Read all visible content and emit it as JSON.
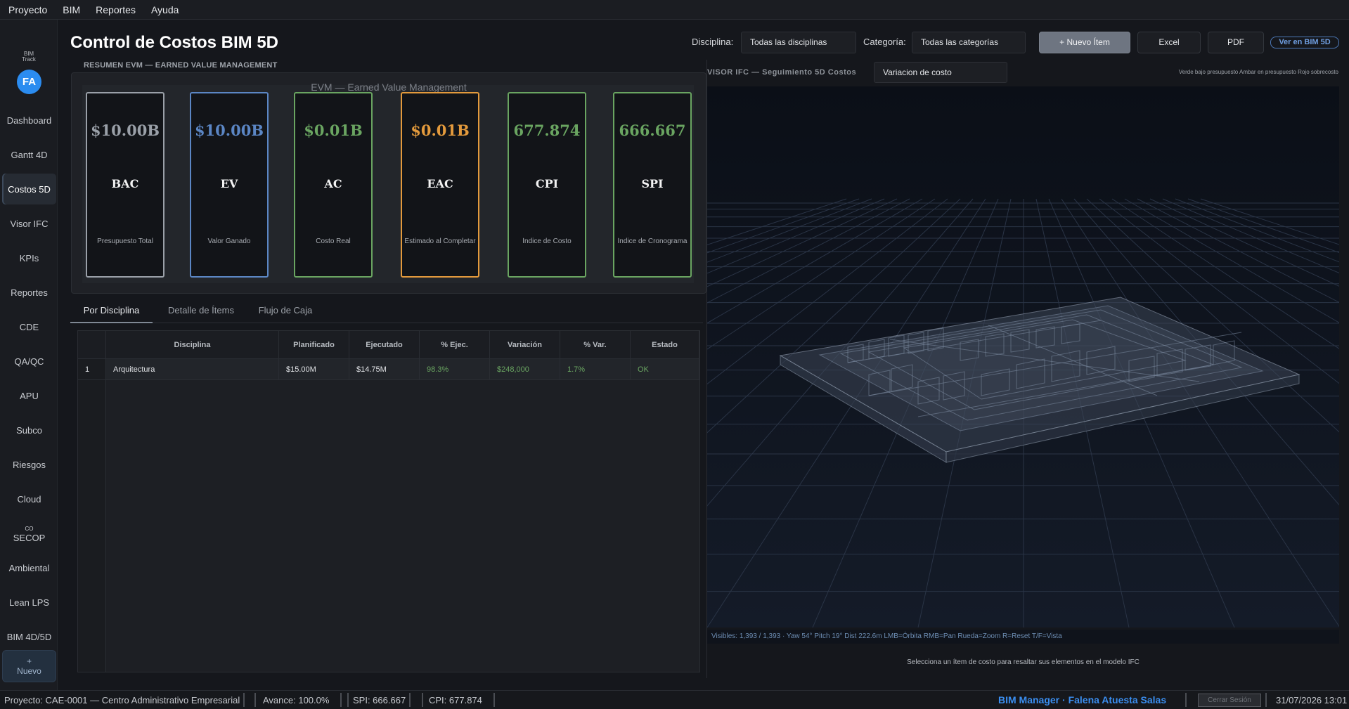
{
  "menu": [
    "Proyecto",
    "BIM",
    "Reportes",
    "Ayuda"
  ],
  "sidebar": {
    "brand_line1": "BIM",
    "brand_line2": "Track",
    "avatar": "FA",
    "items": [
      {
        "label": "Dashboard"
      },
      {
        "label": "Gantt 4D"
      },
      {
        "label": "Costos 5D",
        "active": true
      },
      {
        "label": "Visor IFC"
      },
      {
        "label": "KPIs"
      },
      {
        "label": "Reportes"
      },
      {
        "label": "CDE"
      },
      {
        "label": "QA/QC"
      },
      {
        "label": "APU"
      },
      {
        "label": "Subco"
      },
      {
        "label": "Riesgos"
      },
      {
        "label": "Cloud"
      },
      {
        "label": "SECOP",
        "prefix": "CO"
      },
      {
        "label": "Ambiental"
      },
      {
        "label": "Lean LPS"
      },
      {
        "label": "BIM 4D/5D"
      }
    ],
    "new_plus": "+",
    "new_label": "Nuevo"
  },
  "header": {
    "title": "Control de Costos BIM 5D",
    "disciplina_label": "Disciplina:",
    "disciplina_value": "Todas las disciplinas",
    "categoria_label": "Categoría:",
    "categoria_value": "Todas las categorías",
    "nuevo_item": "+ Nuevo Ítem",
    "excel": "Excel",
    "pdf": "PDF",
    "ver_bim": "Ver en BIM 5D"
  },
  "evm": {
    "heading": "RESUMEN EVM — EARNED VALUE MANAGEMENT",
    "panel_title": "EVM — Earned Value Management",
    "cards": [
      {
        "value": "$10.00B",
        "label": "BAC",
        "desc": "Presupuesto Total",
        "color": "#9aa0a8"
      },
      {
        "value": "$10.00B",
        "label": "EV",
        "desc": "Valor Ganado",
        "color": "#5b86c4"
      },
      {
        "value": "$0.01B",
        "label": "AC",
        "desc": "Costo Real",
        "color": "#6aa561"
      },
      {
        "value": "$0.01B",
        "label": "EAC",
        "desc": "Estimado al Completar",
        "color": "#e39a3c"
      },
      {
        "value": "677.874",
        "label": "CPI",
        "desc": "Índice de Costo",
        "color": "#6aa561"
      },
      {
        "value": "666.667",
        "label": "SPI",
        "desc": "Índice de Cronograma",
        "color": "#6aa561"
      }
    ]
  },
  "tabs": [
    {
      "label": "Por Disciplina",
      "active": true
    },
    {
      "label": "Detalle de Ítems"
    },
    {
      "label": "Flujo de Caja"
    }
  ],
  "table": {
    "headers": [
      "Disciplina",
      "Planificado",
      "Ejecutado",
      "% Ejec.",
      "Variación",
      "% Var.",
      "Estado"
    ],
    "rows": [
      {
        "index": "1",
        "cells": [
          "Arquitectura",
          "$15.00M",
          "$14.75M",
          "98.3%",
          "$248,000",
          "1.7%",
          "OK"
        ]
      }
    ],
    "positive_color": "#6aa561"
  },
  "viewer": {
    "title": "VISOR IFC — Seguimiento 5D Costos",
    "mode_value": "Variacion de costo",
    "legend": "Verde bajo presupuesto Ambar en presupuesto Rojo sobrecosto",
    "status": "Visibles: 1,393 / 1,393 · Yaw 54° Pitch 19° Dist 222.6m  LMB=Órbita RMB=Pan Rueda=Zoom R=Reset T/F=Vista",
    "hint": "Selecciona un ítem de costo para resaltar sus elementos en el modelo IFC"
  },
  "statusbar": {
    "project": "Proyecto: CAE-0001 — Centro Administrativo Empresarial",
    "avance": "Avance: 100.0%",
    "spi": "SPI: 666.667",
    "cpi": "CPI: 677.874",
    "user": "BIM Manager · Falena Atuesta Salas",
    "logout": "Cerrar Sesión",
    "datetime": "31/07/2026 13:01"
  }
}
